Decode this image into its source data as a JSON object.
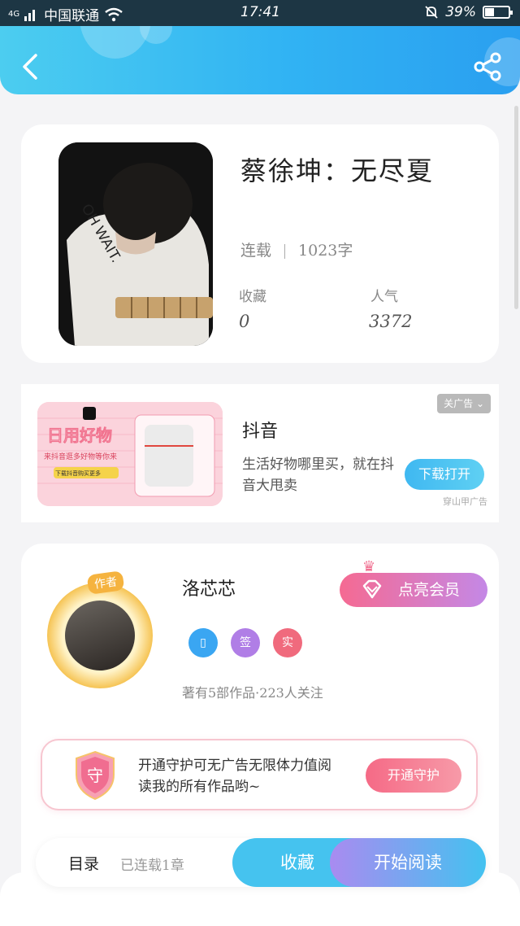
{
  "status_bar": {
    "network": "4G",
    "carrier": "中国联通",
    "time": "17:41",
    "battery": "39%",
    "battery_level": 0.39
  },
  "book": {
    "title": "蔡徐坤：无尽夏",
    "status": "连载",
    "word_count": "1023字",
    "favorites_label": "收藏",
    "favorites_value": "0",
    "popularity_label": "人气",
    "popularity_value": "3372",
    "cover_text": "OH WAIT."
  },
  "ad": {
    "image_text": "日用好物",
    "image_subtext": "来抖音逛多好物等你来",
    "image_button": "下载抖音购买更多",
    "title": "抖音",
    "description": "生活好物哪里买，就在抖音大甩卖",
    "action": "下载打开",
    "close_label": "关广告",
    "source": "穿山甲广告"
  },
  "author": {
    "tag": "作者",
    "name": "洛芯芯",
    "vip_button": "点亮会员",
    "badges": [
      {
        "label": "▯",
        "color": "#3aa6f2"
      },
      {
        "label": "签",
        "color": "#b07ee6"
      },
      {
        "label": "实",
        "color": "#f06a7d"
      }
    ],
    "works": "著有5部作品·223人关注",
    "guard_icon": "守",
    "guard_text": "开通守护可无广告无限体力值阅读我的所有作品哟~",
    "guard_button": "开通守护"
  },
  "bottom": {
    "toc": "目录",
    "chapters": "已连载1章",
    "collect": "收藏",
    "read": "开始阅读"
  },
  "colors": {
    "header_start": "#4ccdf0",
    "header_end": "#2a9ff0",
    "vip_start": "#f56a92",
    "vip_end": "#c488e6"
  }
}
